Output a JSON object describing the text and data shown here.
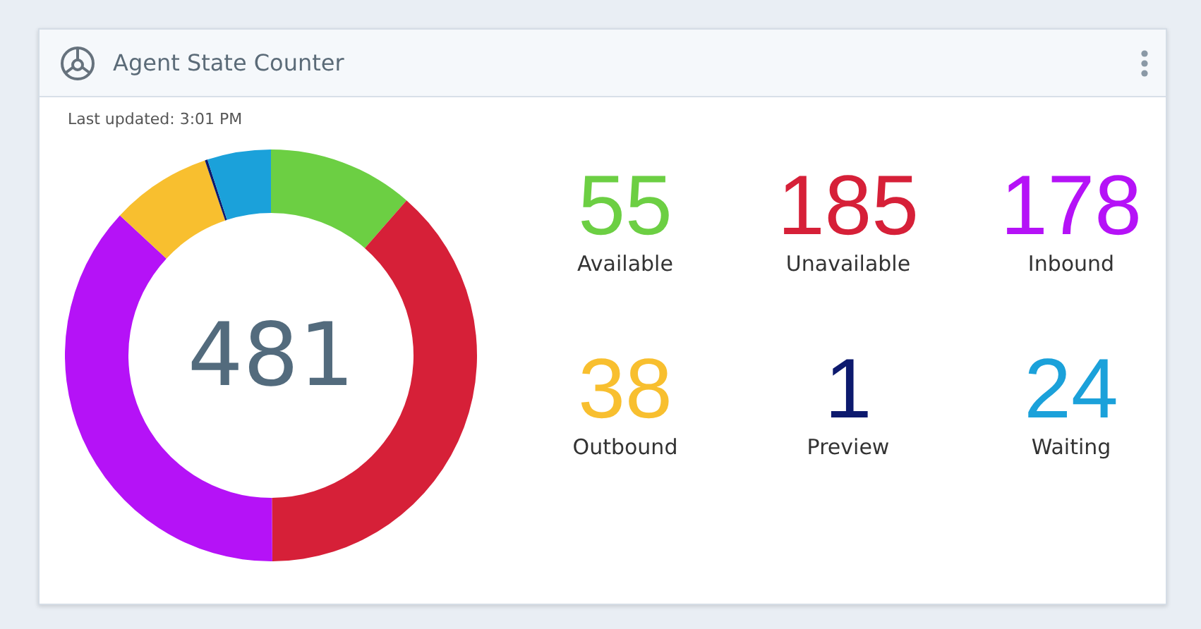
{
  "widget": {
    "title": "Agent State Counter",
    "updated": "Last updated: 3:01 PM",
    "total": "481",
    "stats": [
      {
        "count": "55",
        "label": "Available",
        "color": "#6ccf43"
      },
      {
        "count": "185",
        "label": "Unavailable",
        "color": "#d62038"
      },
      {
        "count": "178",
        "label": "Inbound",
        "color": "#b512f7"
      },
      {
        "count": "38",
        "label": "Outbound",
        "color": "#f8bf2f"
      },
      {
        "count": "1",
        "label": "Preview",
        "color": "#0d1a6e"
      },
      {
        "count": "24",
        "label": "Waiting",
        "color": "#1ba1da"
      }
    ]
  }
}
